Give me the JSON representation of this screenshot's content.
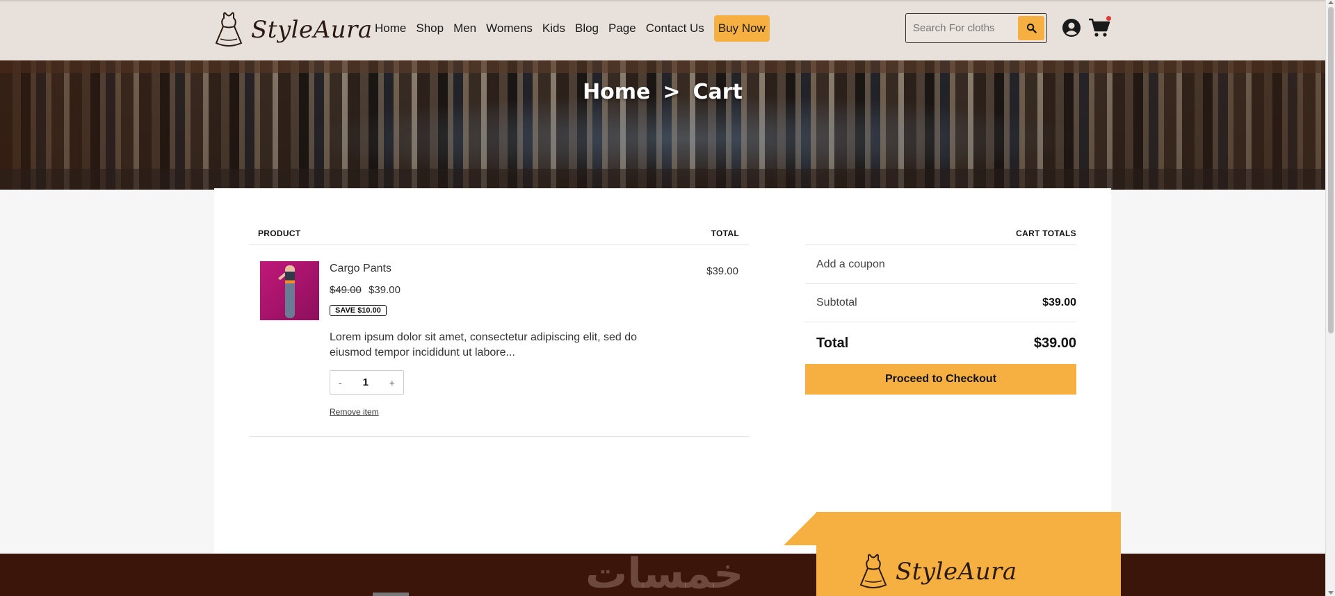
{
  "header": {
    "logo_text": "StyleAura",
    "nav": [
      {
        "label": "Home"
      },
      {
        "label": "Shop"
      },
      {
        "label": "Men"
      },
      {
        "label": "Womens"
      },
      {
        "label": "Kids"
      },
      {
        "label": "Blog"
      },
      {
        "label": "Page"
      },
      {
        "label": "Contact Us"
      }
    ],
    "buy_now_label": "Buy Now",
    "search": {
      "placeholder": "Search For cloths"
    },
    "icons": {
      "search": "search-icon",
      "user": "user-icon",
      "cart": "cart-icon"
    },
    "accent_color": "#f5b041"
  },
  "hero": {
    "breadcrumb_home": "Home",
    "breadcrumb_sep": ">",
    "breadcrumb_current": "Cart"
  },
  "cart": {
    "col_product": "PRODUCT",
    "col_total": "TOTAL",
    "items": [
      {
        "name": "Cargo Pants",
        "old_price": "$49.00",
        "price": "$39.00",
        "save_badge": "SAVE $10.00",
        "description": "Lorem ipsum dolor sit amet, consectetur adipiscing elit, sed do eiusmod tempor incididunt ut labore...",
        "qty_minus": "-",
        "quantity": "1",
        "qty_plus": "+",
        "remove_label": "Remove item",
        "line_total": "$39.00"
      }
    ]
  },
  "totals": {
    "heading": "CART TOTALS",
    "coupon_label": "Add a coupon",
    "subtotal_label": "Subtotal",
    "subtotal_value": "$39.00",
    "total_label": "Total",
    "total_value": "$39.00",
    "checkout_label": "Proceed to Checkout"
  },
  "footer": {
    "watermark": "خمسات",
    "logo_text": "StyleAura",
    "bg_color": "#3b1509"
  }
}
